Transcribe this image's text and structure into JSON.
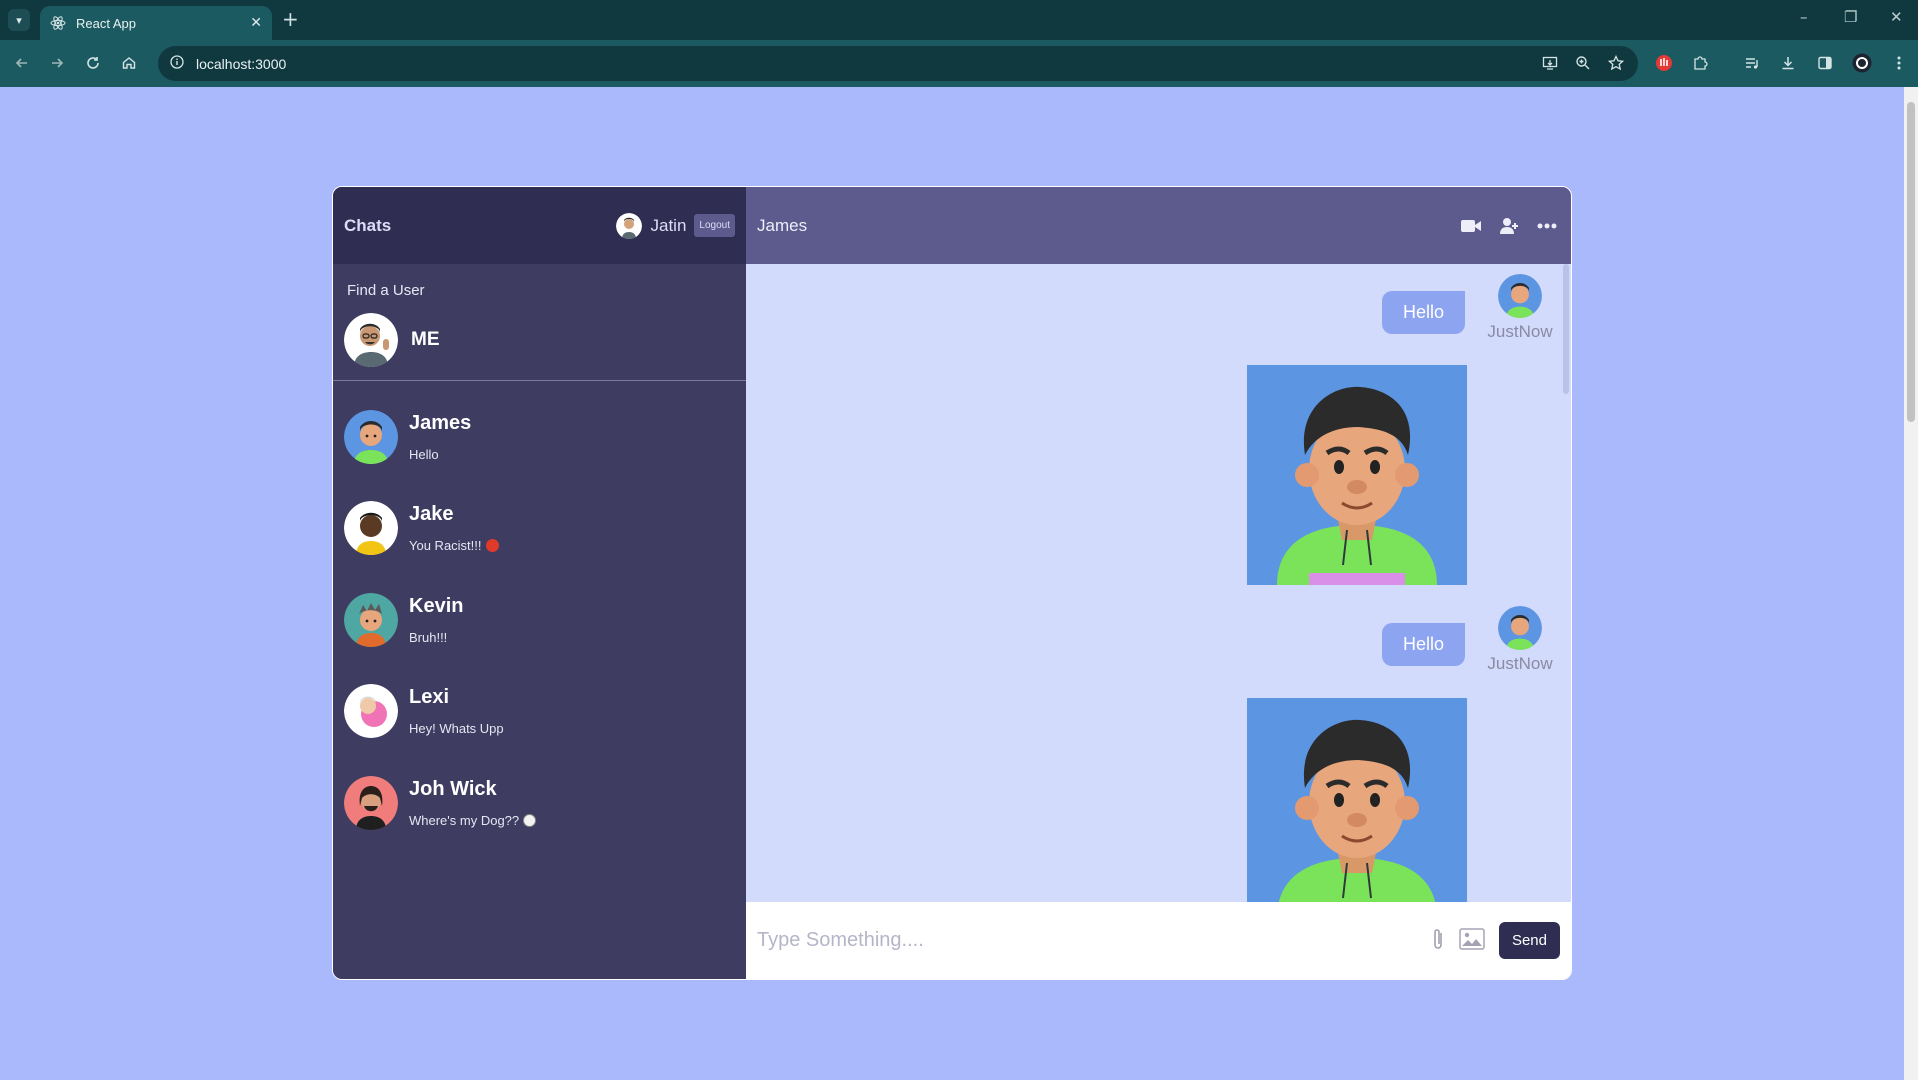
{
  "browser": {
    "tab_title": "React App",
    "url": "localhost:3000",
    "tab_close_glyph": "✕",
    "new_tab_glyph": "+",
    "window_controls": [
      "–",
      "❐",
      "✕"
    ]
  },
  "app": {
    "colors": {
      "page_bg": "#aab8fc",
      "sidebar_bg": "#3e3c61",
      "sidebar_head_bg": "#2f2d52",
      "chat_head_bg": "#5d5b8d",
      "messages_bg": "#d3dbfc",
      "bubble_bg": "#8da4f1",
      "send_bg": "#2f2d52"
    },
    "sidebar": {
      "brand": "Chats",
      "current_user": "Jatin",
      "logout_label": "Logout",
      "search_label": "Find a User",
      "search_result": "ME",
      "chats": [
        {
          "name": "James",
          "last_message": "Hello",
          "emoji": ""
        },
        {
          "name": "Jake",
          "last_message": "You Racist!!!",
          "emoji": "angry-face"
        },
        {
          "name": "Kevin",
          "last_message": "Bruh!!!",
          "emoji": ""
        },
        {
          "name": "Lexi",
          "last_message": "Hey! Whats Upp",
          "emoji": ""
        },
        {
          "name": "Joh Wick",
          "last_message": "Where's my Dog??",
          "emoji": "dog-face"
        }
      ]
    },
    "chat": {
      "title": "James",
      "header_icons": [
        "video-camera-icon",
        "add-user-icon",
        "more-icon"
      ],
      "messages": [
        {
          "type": "text",
          "text": "Hello",
          "time": "JustNow"
        },
        {
          "type": "image"
        },
        {
          "type": "text",
          "text": "Hello",
          "time": "JustNow"
        },
        {
          "type": "image"
        }
      ],
      "composer": {
        "placeholder": "Type Something....",
        "value": "",
        "send_label": "Send",
        "icons": [
          "attach-icon",
          "image-icon"
        ]
      }
    }
  }
}
